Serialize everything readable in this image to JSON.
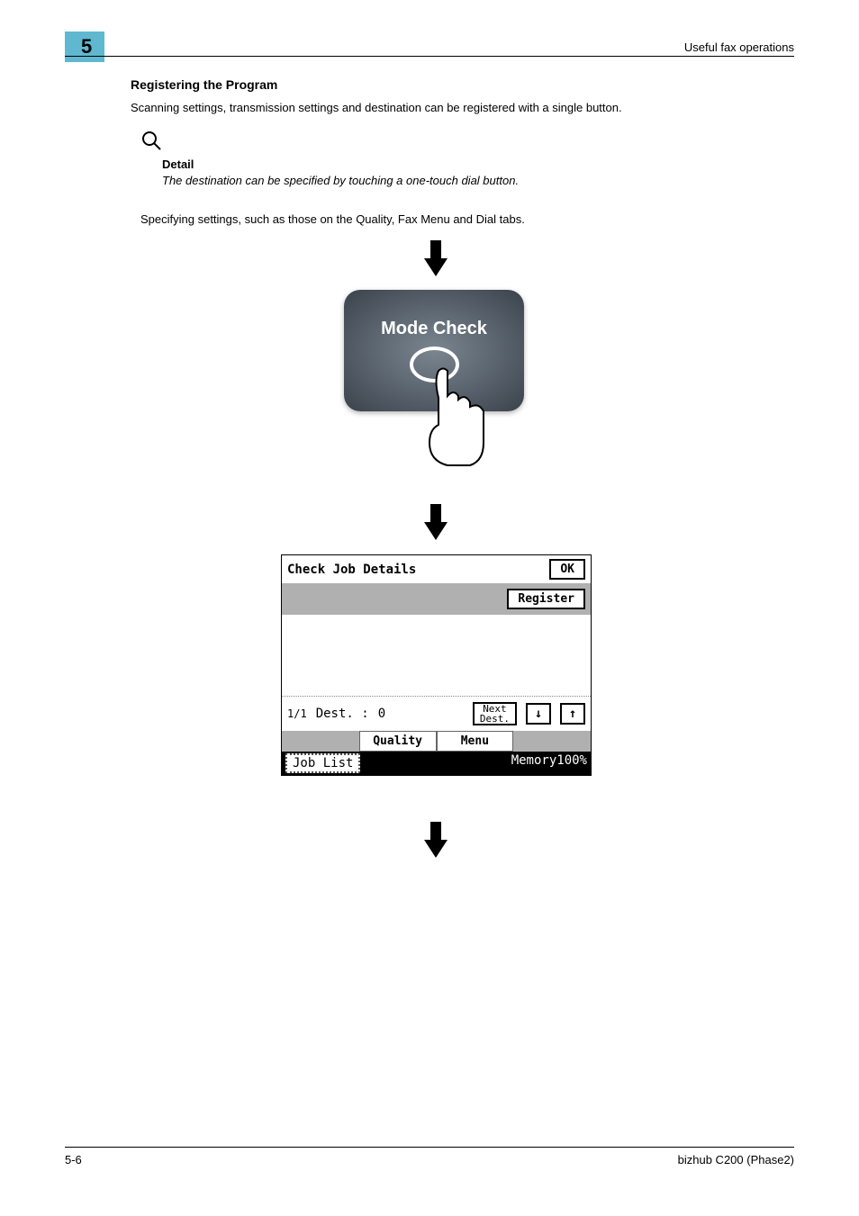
{
  "header": {
    "chapter": "5",
    "label": "Useful fax operations"
  },
  "section_title": "Registering the Program",
  "paragraph1": "Scanning settings, transmission settings and destination can be registered with a single button.",
  "detail": {
    "label": "Detail",
    "text": "The destination can be specified by touching a one-touch dial button."
  },
  "spec_text": "Specifying settings, such as those on the Quality, Fax Menu and Dial tabs.",
  "mode_check": {
    "label": "Mode Check"
  },
  "screen": {
    "title": "Check Job Details",
    "ok": "OK",
    "register": "Register",
    "dest_counter": "1/1",
    "dest_label": "Dest. :",
    "dest_value": "0",
    "next_dest": "Next\nDest.",
    "tabs": {
      "quality": "Quality",
      "menu": "Menu"
    },
    "job_list": "Job List",
    "memory": "Memory100%"
  },
  "footer": {
    "page": "5-6",
    "product": "bizhub C200 (Phase2)"
  }
}
